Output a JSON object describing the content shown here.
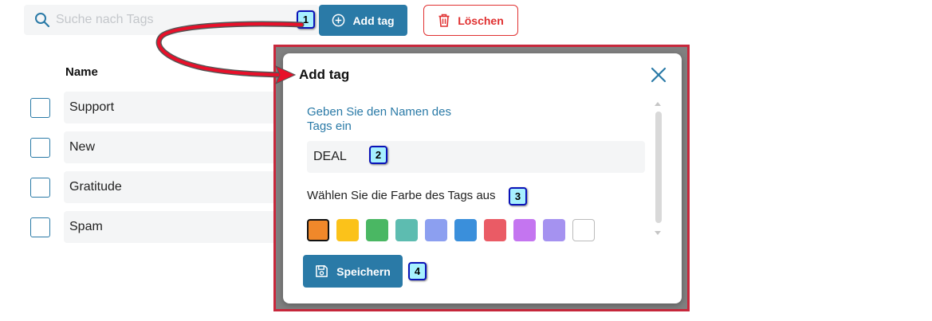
{
  "toolbar": {
    "search_placeholder": "Suche nach Tags",
    "add_label": "Add tag",
    "delete_label": "Löschen"
  },
  "table": {
    "header": "Name",
    "rows": [
      "Support",
      "New",
      "Gratitude",
      "Spam"
    ]
  },
  "modal": {
    "title": "Add tag",
    "name_label": "Geben Sie den Namen des Tags ein",
    "name_value": "DEAL",
    "color_label": "Wählen Sie die Farbe des Tags aus",
    "colors": [
      "#f0882a",
      "#fbc21a",
      "#4ab763",
      "#5dbcb0",
      "#8c9ff0",
      "#3a8fdb",
      "#ea5b65",
      "#c475f0",
      "#a592f0",
      "#ffffff"
    ],
    "selected_color_index": 0,
    "save_label": "Speichern"
  },
  "markers": [
    "1",
    "2",
    "3",
    "4"
  ],
  "theme": {
    "accent": "#2a7aa7",
    "danger": "#e03131",
    "marker_fill": "#a7f0ff",
    "marker_border": "#0a12b8",
    "annotation_red": "#e8102a"
  }
}
